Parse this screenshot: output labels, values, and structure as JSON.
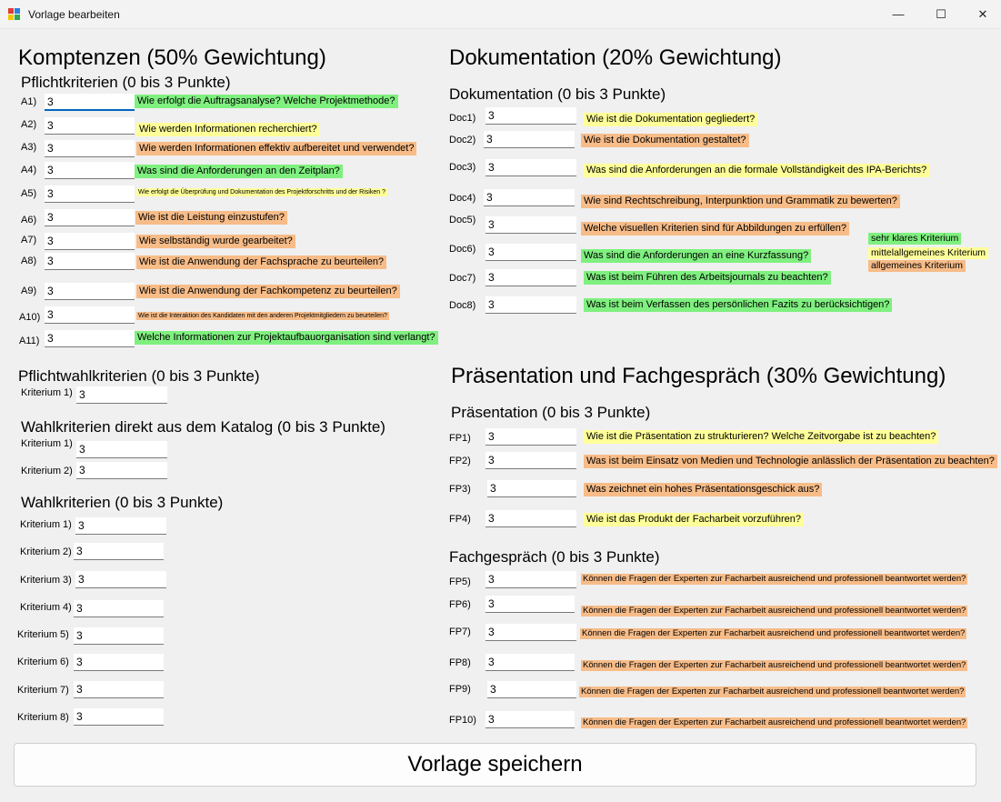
{
  "window": {
    "title": "Vorlage bearbeiten",
    "minimize": "—",
    "maximize": "☐",
    "close": "✕"
  },
  "colors": {
    "green": "#7ff07f",
    "yellow": "#ffff99",
    "orange": "#f7bc88"
  },
  "left": {
    "title": "Komptenzen (50% Gewichtung)",
    "pflicht": {
      "title": "Pflichtkriterien (0 bis 3 Punkte)",
      "items": [
        {
          "label": "A1)",
          "value": "3",
          "question": "Wie erfolgt die Auftragsanalyse? Welche Projektmethode?"
        },
        {
          "label": "A2)",
          "value": "3",
          "question": "Wie werden Informationen recherchiert?"
        },
        {
          "label": "A3)",
          "value": "3",
          "question": "Wie werden Informationen effektiv aufbereitet und verwendet?"
        },
        {
          "label": "A4)",
          "value": "3",
          "question": "Was sind die Anforderungen an den Zeitplan?"
        },
        {
          "label": "A5)",
          "value": "3",
          "question": "Wie erfolgt die Überprüfung und Dokumentation des Projektforschritts und der Risiken ?"
        },
        {
          "label": "A6)",
          "value": "3",
          "question": "Wie ist die Leistung einzustufen?"
        },
        {
          "label": "A7)",
          "value": "3",
          "question": "Wie selbständig wurde gearbeitet?"
        },
        {
          "label": "A8)",
          "value": "3",
          "question": "Wie ist die Anwendung der Fachsprache zu beurteilen?"
        },
        {
          "label": "A9)",
          "value": "3",
          "question": "Wie ist die Anwendung der Fachkompetenz zu beurteilen?"
        },
        {
          "label": "A10)",
          "value": "3",
          "question": "Wie ist die Interaktion des Kandidaten mit den anderen Projektmitgliedern zu beurteilen?"
        },
        {
          "label": "A11)",
          "value": "3",
          "question": "Welche Informationen zur Projektaufbauorganisation sind verlangt?"
        }
      ]
    },
    "pflichtwahl": {
      "title": "Pflichtwahlkriterien (0 bis 3 Punkte)",
      "items": [
        {
          "label": "Kriterium 1)",
          "value": "3"
        }
      ]
    },
    "katalog": {
      "title": "Wahlkriterien direkt aus dem Katalog (0 bis 3 Punkte)",
      "items": [
        {
          "label": "Kriterium 1)",
          "value": "3"
        },
        {
          "label": "Kriterium 2)",
          "value": "3"
        }
      ]
    },
    "wahl": {
      "title": "Wahlkriterien (0 bis 3 Punkte)",
      "items": [
        {
          "label": "Kriterium 1)",
          "value": "3"
        },
        {
          "label": "Kriterium 2)",
          "value": "3"
        },
        {
          "label": "Kriterium 3)",
          "value": "3"
        },
        {
          "label": "Kriterium 4)",
          "value": "3"
        },
        {
          "label": "Kriterium 5)",
          "value": "3"
        },
        {
          "label": "Kriterium 6)",
          "value": "3"
        },
        {
          "label": "Kriterium 7)",
          "value": "3"
        },
        {
          "label": "Kriterium 8)",
          "value": "3"
        }
      ]
    }
  },
  "right": {
    "title": "Dokumentation (20% Gewichtung)",
    "doc": {
      "title": "Dokumentation (0 bis 3 Punkte)",
      "items": [
        {
          "label": "Doc1)",
          "value": "3",
          "question": "Wie ist die Dokumentation gegliedert?"
        },
        {
          "label": "Doc2)",
          "value": "3",
          "question": "Wie ist die Dokumentation gestaltet?"
        },
        {
          "label": "Doc3)",
          "value": "3",
          "question": "Was sind die Anforderungen an die formale Vollständigkeit des IPA-Berichts?"
        },
        {
          "label": "Doc4)",
          "value": "3",
          "question": "Wie sind Rechtschreibung, Interpunktion und Grammatik zu bewerten?"
        },
        {
          "label": "Doc5)",
          "value": "3",
          "question": "Welche visuellen Kriterien sind für Abbildungen zu erfüllen?"
        },
        {
          "label": "Doc6)",
          "value": "3",
          "question": "Was sind die Anforderungen an eine Kurzfassung?"
        },
        {
          "label": "Doc7)",
          "value": "3",
          "question": "Was ist beim Führen des Arbeitsjournals zu beachten?"
        },
        {
          "label": "Doc8)",
          "value": "3",
          "question": "Was ist beim Verfassen des persönlichen Fazits zu berücksichtigen?"
        }
      ]
    },
    "legend": {
      "green": "sehr klares Kriterium",
      "yellow": "mittelallgemeines Kriterium",
      "orange": "allgemeines Kriterium"
    },
    "praes_title": "Präsentation und Fachgespräch (30% Gewichtung)",
    "praes": {
      "title": "Präsentation (0 bis 3 Punkte)",
      "items": [
        {
          "label": "FP1)",
          "value": "3",
          "question": "Wie ist die Präsentation zu strukturieren? Welche Zeitvorgabe ist zu beachten?"
        },
        {
          "label": "FP2)",
          "value": "3",
          "question": "Was ist beim Einsatz von Medien und Technologie anlässlich der Präsentation zu beachten?"
        },
        {
          "label": "FP3)",
          "value": "3",
          "question": "Was zeichnet ein hohes Präsentationsgeschick aus?"
        },
        {
          "label": "FP4)",
          "value": "3",
          "question": "Wie ist das Produkt der Facharbeit vorzuführen?"
        }
      ]
    },
    "fach": {
      "title": "Fachgespräch (0 bis 3 Punkte)",
      "items": [
        {
          "label": "FP5)",
          "value": "3",
          "question": "Können die Fragen der Experten zur Facharbeit ausreichend und professionell beantwortet werden?"
        },
        {
          "label": "FP6)",
          "value": "3",
          "question": "Können die Fragen der Experten zur Facharbeit ausreichend und professionell beantwortet werden?"
        },
        {
          "label": "FP7)",
          "value": "3",
          "question": "Können die Fragen der Experten zur Facharbeit ausreichend und professionell beantwortet werden?"
        },
        {
          "label": "FP8)",
          "value": "3",
          "question": "Können die Fragen der Experten zur Facharbeit ausreichend und professionell beantwortet werden?"
        },
        {
          "label": "FP9)",
          "value": "3",
          "question": "Können die Fragen der Experten zur Facharbeit ausreichend und professionell beantwortet werden?"
        },
        {
          "label": "FP10)",
          "value": "3",
          "question": "Können die Fragen der Experten zur Facharbeit ausreichend und professionell beantwortet werden?"
        }
      ]
    }
  },
  "save_button": "Vorlage speichern"
}
